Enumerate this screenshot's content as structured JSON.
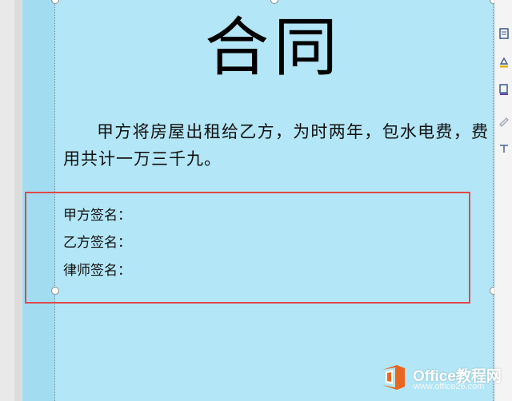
{
  "document": {
    "title": "合同",
    "paragraph": "甲方将房屋出租给乙方，为时两年，包水电费，费用共计一万三千九。",
    "signatures": [
      "甲方签名：",
      "乙方签名：",
      "律师签名："
    ]
  },
  "watermark": {
    "name": "Office教程网",
    "url": "www.office26.com"
  },
  "colors": {
    "page_background": "#b3e6f6",
    "selection_outline": "#e04a4a",
    "logo_orange": "#e8661f"
  },
  "right_toolbar": {
    "icons": [
      "layout-options-icon",
      "shape-fill-icon",
      "shape-outline-icon",
      "effects-icon",
      "text-wrap-icon"
    ]
  }
}
